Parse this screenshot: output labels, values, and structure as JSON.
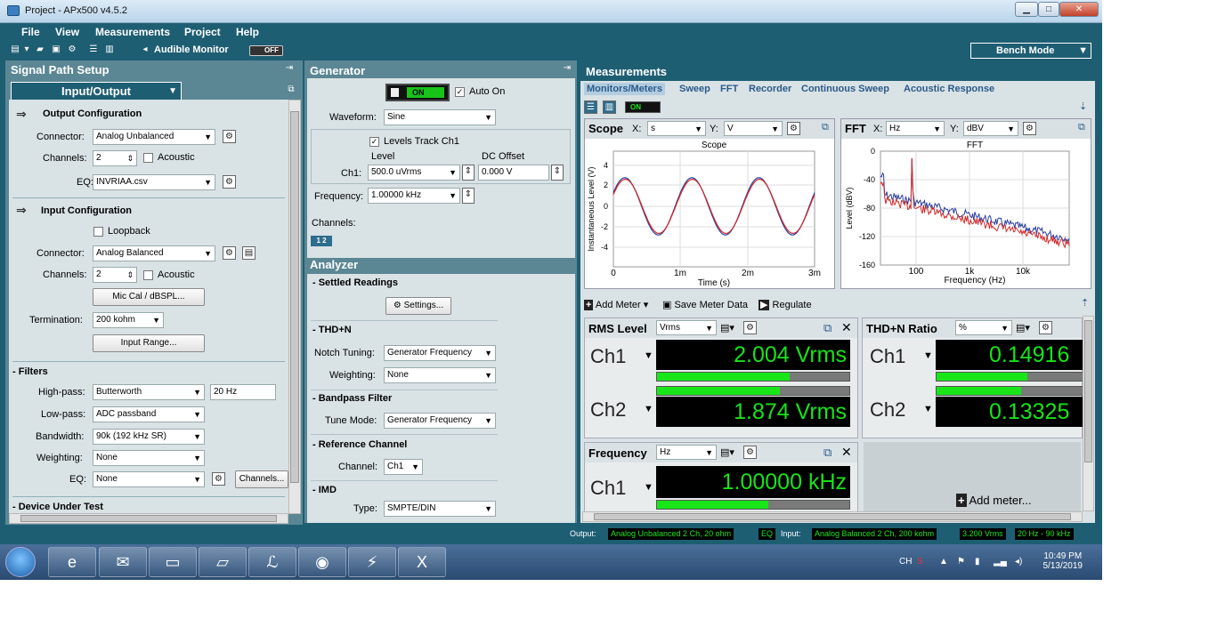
{
  "window": {
    "title": "Project - APx500 v4.5.2",
    "min": "▁",
    "max": "□",
    "close": "✕"
  },
  "menu": [
    "File",
    "View",
    "Measurements",
    "Project",
    "Help"
  ],
  "toolbar": {
    "audible_monitor": "Audible Monitor",
    "monitor_toggle": "OFF",
    "bench_mode": "Bench Mode"
  },
  "signal_path": {
    "title": "Signal Path Setup",
    "selector": "Input/Output",
    "output": {
      "title": "Output Configuration",
      "connector_label": "Connector:",
      "connector": "Analog Unbalanced",
      "channels_label": "Channels:",
      "channels": "2",
      "acoustic": "Acoustic",
      "eq_label": "EQ:",
      "eq": "INVRIAA.csv"
    },
    "input": {
      "title": "Input Configuration",
      "loopback": "Loopback",
      "connector_label": "Connector:",
      "connector": "Analog Balanced",
      "channels_label": "Channels:",
      "channels": "2",
      "acoustic": "Acoustic",
      "mic_cal": "Mic Cal / dBSPL...",
      "termination_label": "Termination:",
      "termination": "200 kohm",
      "input_range": "Input Range..."
    },
    "filters": {
      "title": "- Filters",
      "highpass_label": "High-pass:",
      "highpass": "Butterworth",
      "highpass_freq": "20 Hz",
      "lowpass_label": "Low-pass:",
      "lowpass": "ADC passband",
      "bandwidth_label": "Bandwidth:",
      "bandwidth": "90k (192 kHz SR)",
      "weighting_label": "Weighting:",
      "weighting": "None",
      "eq_label": "EQ:",
      "eq": "None",
      "channels_btn": "Channels..."
    },
    "dut": "- Device Under Test"
  },
  "generator": {
    "title": "Generator",
    "switch": "ON",
    "auto_on": "Auto On",
    "waveform_label": "Waveform:",
    "waveform": "Sine",
    "levels_track": "Levels Track Ch1",
    "level_col": "Level",
    "dc_col": "DC Offset",
    "ch1_label": "Ch1:",
    "level": "500.0 uVrms",
    "dc_offset": "0.000 V",
    "frequency_label": "Frequency:",
    "frequency": "1.00000 kHz",
    "channels_label": "Channels:",
    "ch_btn": "1 2"
  },
  "analyzer": {
    "title": "Analyzer",
    "settled": "- Settled Readings",
    "settings": "Settings...",
    "thdn": "- THD+N",
    "notch_label": "Notch Tuning:",
    "notch": "Generator Frequency",
    "weighting_label": "Weighting:",
    "weighting": "None",
    "bandpass": "- Bandpass Filter",
    "tune_label": "Tune Mode:",
    "tune": "Generator Frequency",
    "refch": "- Reference Channel",
    "channel_label": "Channel:",
    "channel": "Ch1",
    "imd": "- IMD",
    "type_label": "Type:",
    "type": "SMPTE/DIN"
  },
  "measurements": {
    "title": "Measurements",
    "tabs": [
      "Monitors/Meters",
      "Sweep",
      "FFT",
      "Recorder",
      "Continuous Sweep",
      "Acoustic Response"
    ],
    "toggle": "ON",
    "scope": {
      "title": "Scope",
      "x_label": "X:",
      "x_unit": "s",
      "y_label": "Y:",
      "y_unit": "V",
      "graph_title": "Scope",
      "ylabel": "Instantaneous Level (V)",
      "xlabel": "Time (s)",
      "yticks": [
        "4",
        "2",
        "0",
        "-2",
        "-4"
      ],
      "xticks": [
        "0",
        "1m",
        "2m",
        "3m"
      ]
    },
    "fft": {
      "title": "FFT",
      "x_label": "X:",
      "x_unit": "Hz",
      "y_label": "Y:",
      "y_unit": "dBV",
      "graph_title": "FFT",
      "ylabel": "Level (dBV)",
      "xlabel": "Frequency (Hz)",
      "yticks": [
        "0",
        "-40",
        "-80",
        "-120",
        "-160"
      ],
      "xticks": [
        "100",
        "1k",
        "10k"
      ]
    },
    "meter_bar": {
      "add_meter": "Add Meter",
      "save": "Save Meter Data",
      "regulate": "Regulate"
    },
    "rms": {
      "title": "RMS Level",
      "unit": "Vrms",
      "ch1": "Ch1",
      "ch2": "Ch2",
      "v1": "2.004  Vrms",
      "v2": "1.874  Vrms",
      "bar1": 0.69,
      "bar2": 0.64
    },
    "thdn": {
      "title": "THD+N Ratio",
      "unit": "%",
      "ch1": "Ch1",
      "ch2": "Ch2",
      "v1": "0.14916",
      "v2": "0.13325",
      "bar1": 0.62,
      "bar2": 0.58
    },
    "freq": {
      "title": "Frequency",
      "unit": "Hz",
      "ch1": "Ch1",
      "v1": "1.00000  kHz",
      "bar1": 0.58
    },
    "add_meter_tile": "Add meter..."
  },
  "status": {
    "output_label": "Output:",
    "output": "Analog Unbalanced 2 Ch, 20 ohm",
    "eq": "EQ",
    "input_label": "Input:",
    "input": "Analog Balanced 2 Ch, 200 kohm",
    "range": "3.200 Vrms",
    "bw": "20 Hz - 90 kHz"
  },
  "taskbar": {
    "lang": "CH",
    "time": "10:49 PM",
    "date": "5/13/2019"
  },
  "colors": {
    "bg": "#1e5e73",
    "panel": "#5b8794",
    "lcd_text": "#18e418",
    "series1": "#2b3f9e",
    "series2": "#d12a2a"
  }
}
